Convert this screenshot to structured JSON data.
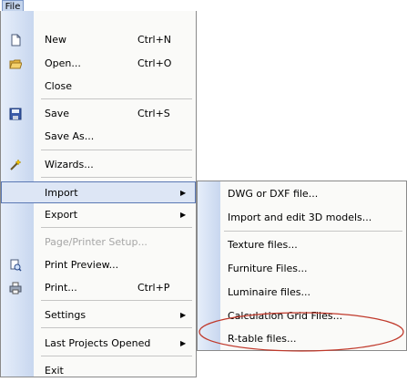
{
  "menubar": {
    "file": "File"
  },
  "file_menu": {
    "items": [
      {
        "label": "New",
        "shortcut": "Ctrl+N",
        "icon": "new-document-icon"
      },
      {
        "label": "Open...",
        "shortcut": "Ctrl+O",
        "icon": "open-folder-icon"
      },
      {
        "label": "Close"
      },
      {
        "label": "Save",
        "shortcut": "Ctrl+S",
        "icon": "save-icon"
      },
      {
        "label": "Save As..."
      },
      {
        "label": "Wizards...",
        "icon": "wizard-icon"
      },
      {
        "label": "Import",
        "submenu": true,
        "state": "highlighted"
      },
      {
        "label": "Export",
        "submenu": true
      },
      {
        "label": "Page/Printer Setup...",
        "state": "disabled"
      },
      {
        "label": "Print Preview...",
        "icon": "print-preview-icon"
      },
      {
        "label": "Print...",
        "shortcut": "Ctrl+P",
        "icon": "printer-icon"
      },
      {
        "label": "Settings",
        "submenu": true
      },
      {
        "label": "Last Projects Opened",
        "submenu": true
      },
      {
        "label": "Exit"
      }
    ]
  },
  "import_submenu": {
    "items": [
      {
        "label": "DWG or DXF file..."
      },
      {
        "label": "Import and edit 3D models..."
      },
      {
        "label": "Texture files..."
      },
      {
        "label": "Furniture Files..."
      },
      {
        "label": "Luminaire files..."
      },
      {
        "label": "Calculation Grid Files..."
      },
      {
        "label": "R-table files...",
        "annotation": "circled-red"
      }
    ]
  },
  "colors": {
    "highlight_fill": "#dde6f5",
    "highlight_border": "#5a78b4",
    "annotation": "#c0392b"
  }
}
